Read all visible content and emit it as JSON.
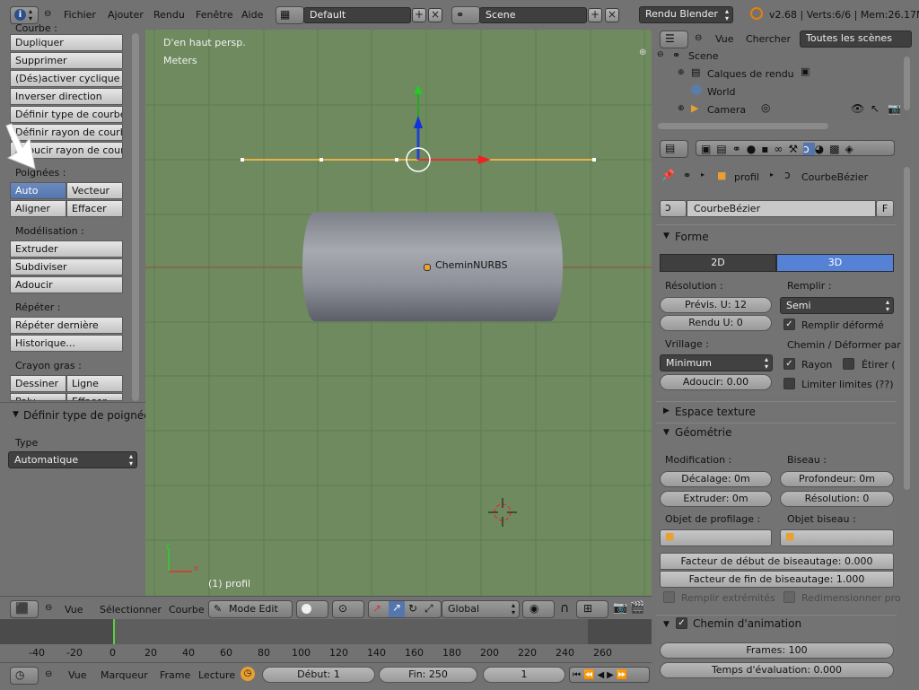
{
  "header": {
    "menu": [
      "Fichier",
      "Ajouter",
      "Rendu",
      "Fenêtre",
      "Aide"
    ],
    "layout": "Default",
    "scene": "Scene",
    "engine": "Rendu Blender",
    "stats": "v2.68 | Verts:6/6 | Mem:26.17M"
  },
  "left_panel": {
    "section_top": "Courbe :",
    "curve_buttons": [
      "Dupliquer",
      "Supprimer",
      "(Dés)activer cyclique",
      "Inverser direction",
      "Définir type de courbe",
      "Définir rayon de courbe",
      "Adoucir rayon de courb"
    ],
    "handles_label": "Poignées :",
    "handles_buttons": [
      "Auto",
      "Vecteur",
      "Aligner",
      "Effacer"
    ],
    "modeling_label": "Modélisation :",
    "modeling_buttons": [
      "Extruder",
      "Subdiviser",
      "Adoucir"
    ],
    "repeat_label": "Répéter :",
    "repeat_buttons": [
      "Répéter dernière",
      "Historique..."
    ],
    "pencil_label": "Crayon gras :",
    "pencil_buttons": [
      "Dessiner",
      "Ligne",
      "Poly",
      "Effacer"
    ],
    "operator_title": "Définir type de poignée",
    "type_label": "Type",
    "type_value": "Automatique"
  },
  "viewport": {
    "view_name": "D'en haut persp.",
    "units": "Meters",
    "object_label": "CheminNURBS",
    "status": "(1) profil",
    "axis_x": "x",
    "axis_y": "y",
    "colors": {
      "bg": "#6e8a5e",
      "grid": "#5e7a50"
    }
  },
  "viewport_header": {
    "menus": [
      "Vue",
      "Sélectionner",
      "Courbe"
    ],
    "mode": "Mode Edit",
    "orientation": "Global"
  },
  "timeline": {
    "ticks": [
      "-40",
      "-20",
      "0",
      "20",
      "40",
      "60",
      "80",
      "100",
      "120",
      "140",
      "160",
      "180",
      "200",
      "220",
      "240",
      "260"
    ],
    "menus": [
      "Vue",
      "Marqueur",
      "Frame",
      "Lecture"
    ],
    "start": "Début: 1",
    "end": "Fin: 250",
    "current": "1"
  },
  "outliner": {
    "menus": [
      "Vue",
      "Chercher"
    ],
    "filter": "Toutes les scènes",
    "items": [
      "Scene",
      "Calques de rendu",
      "World",
      "Camera"
    ]
  },
  "properties": {
    "breadcrumb": [
      "profil",
      "CourbeBézier"
    ],
    "datablock": "CourbeBézier",
    "datablock_flag": "F",
    "forme": {
      "title": "Forme",
      "modes": [
        "2D",
        "3D"
      ],
      "resolution_label": "Résolution :",
      "fill_label": "Remplir :",
      "preview_u": "Prévis. U: 12",
      "render_u": "Rendu U: 0",
      "fill_value": "Semi",
      "fill_deform": "Remplir déformé",
      "twist_label": "Vrillage :",
      "path_label": "Chemin / Déformer par",
      "twist_value": "Minimum",
      "radius": "Rayon",
      "stretch": "Étirer (",
      "smooth": "Adoucir: 0.00",
      "limits": "Limiter limites (??)"
    },
    "texture_space": "Espace texture",
    "geometry": {
      "title": "Géométrie",
      "modification_label": "Modification :",
      "bevel_label": "Biseau :",
      "offset": "Décalage: 0m",
      "depth": "Profondeur: 0m",
      "extrude": "Extruder: 0m",
      "resolution": "Résolution: 0",
      "profile_object": "Objet de profilage :",
      "bevel_object": "Objet biseau :",
      "bevel_start": "Facteur de début de biseautage: 0.000",
      "bevel_end": "Facteur de fin de biseautage: 1.000",
      "fill_caps": "Remplir extrémités",
      "resize": "Redimensionner pro"
    },
    "path_anim": {
      "title": "Chemin d'animation",
      "frames": "Frames: 100",
      "eval_time": "Temps d'évaluation: 0.000"
    }
  }
}
